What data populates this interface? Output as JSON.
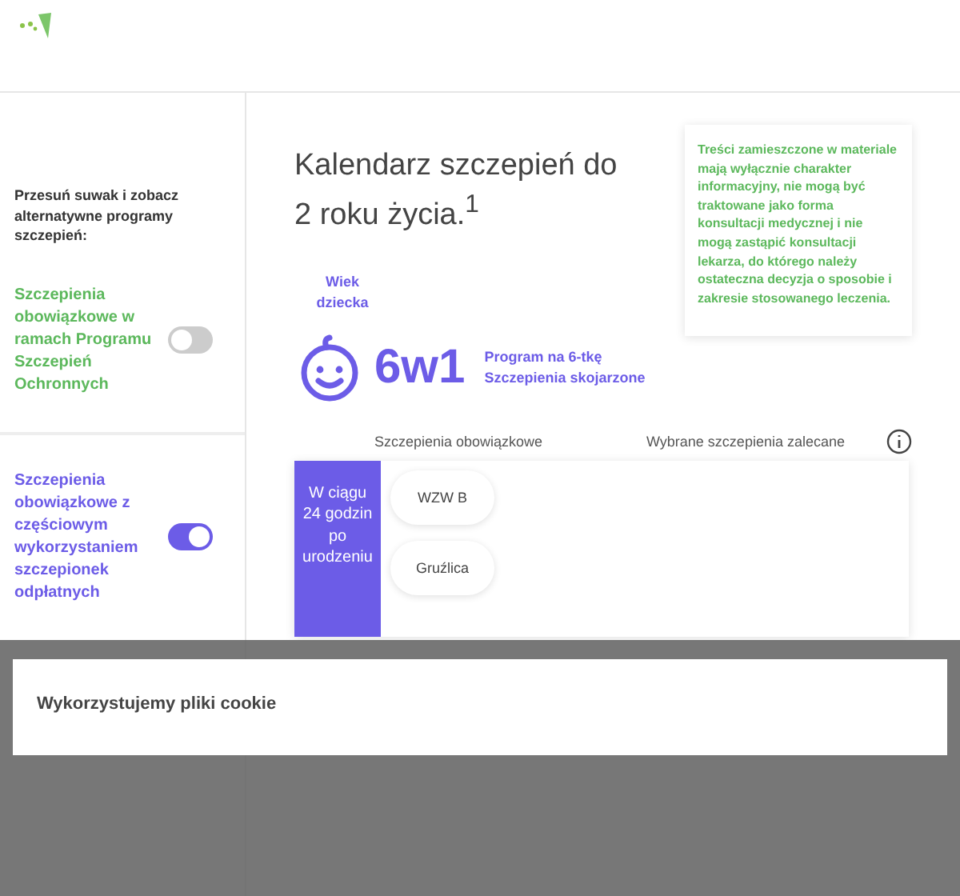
{
  "sidebar": {
    "intro": "Przesuń suwak i zobacz alternatywne programy szczepień:",
    "programs": [
      {
        "label": "Szczepienia obowiązkowe w ramach Programu Szczepień Ochronnych",
        "on": false,
        "color": "#5cb85c"
      },
      {
        "label": "Szczepienia obowiązkowe z częściowym wykorzystaniem szczepionek odpłatnych",
        "on": true,
        "color": "#6c5ce7"
      }
    ]
  },
  "main": {
    "title": "Kalendarz szczepień do 2 roku życia.$^{1}$",
    "disclaimer": "Treści zamieszczone w materiale mają wyłącznie charakter informacyjny, nie mogą być traktowane jako forma konsultacji medycznej i nie mogą zastąpić konsultacji lekarza, do którego należy ostateczna decyzja o sposobie i zakresie stosowanego leczenia.",
    "age_label": "Wiek dziecka",
    "program": {
      "badge": "6w1",
      "caption": [
        "Program na 6-tkę",
        "Szczepienia skojarzone"
      ]
    },
    "columns": [
      "Szczepienia obowiązkowe",
      "Wybrane szczepienia zalecane"
    ],
    "rows": [
      {
        "age": "W ciągu 24 godzin po urodzeniu",
        "mandatory": [
          "WZW B",
          "Gruźlica"
        ]
      }
    ]
  },
  "cookie_banner": {
    "title": "Wykorzystujemy pliki cookie"
  }
}
